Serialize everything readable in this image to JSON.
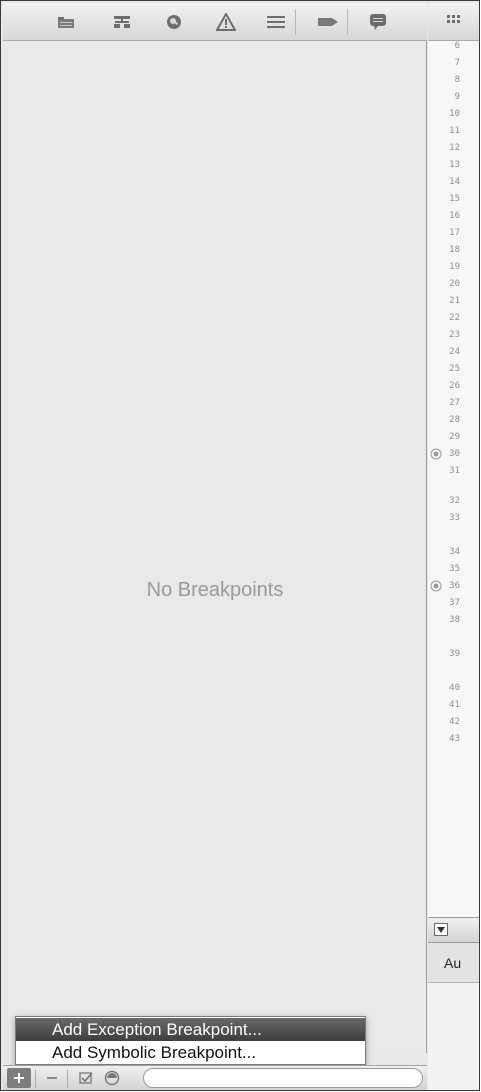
{
  "navigator": {
    "empty_message": "No Breakpoints",
    "toolbar_icons": [
      "folder-icon",
      "hierarchy-icon",
      "search-icon",
      "warning-icon",
      "list-icon",
      "breakpoint-icon",
      "log-icon"
    ]
  },
  "menu": {
    "items": [
      {
        "label": "Add Exception Breakpoint...",
        "highlighted": true
      },
      {
        "label": "Add Symbolic Breakpoint...",
        "highlighted": false
      }
    ]
  },
  "bottom_bar": {
    "icons": [
      "add-icon",
      "remove-icon",
      "checkbox-icon",
      "filter-icon"
    ]
  },
  "editor": {
    "line_numbers": [
      "6",
      "7",
      "8",
      "9",
      "10",
      "11",
      "12",
      "13",
      "14",
      "15",
      "16",
      "17",
      "18",
      "19",
      "20",
      "21",
      "22",
      "23",
      "24",
      "25",
      "26",
      "27",
      "28",
      "29",
      "30",
      "31",
      "32",
      "33",
      "34",
      "35",
      "36",
      "37",
      "38",
      "39",
      "40",
      "41",
      "42",
      "43"
    ],
    "breakpoint_lines": [
      "30",
      "36"
    ],
    "variables_label": "Au"
  },
  "colors": {
    "menu_highlight": "#4f4f4f",
    "navigator_bg": "#e9e9e9",
    "empty_text": "#9a9a9a"
  }
}
